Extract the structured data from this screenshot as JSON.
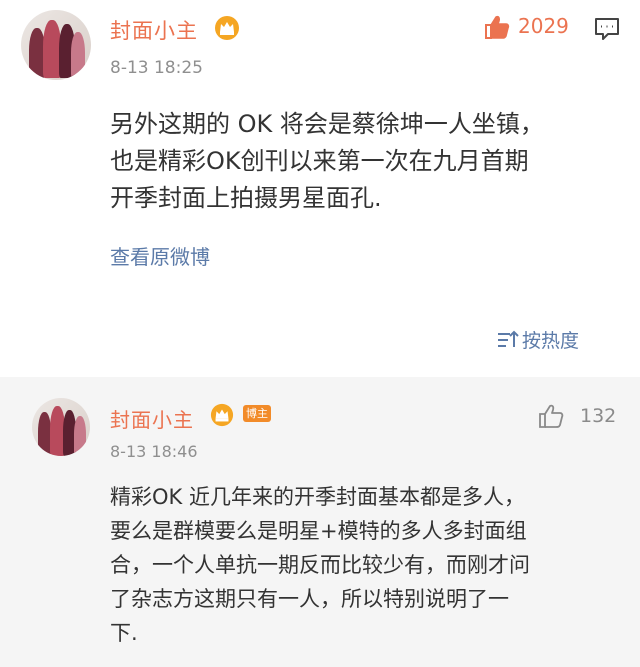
{
  "post": {
    "author": "封面小主",
    "timestamp": "8-13 18:25",
    "like_count": "2029",
    "content_lines": [
      "另外这期的 OK 将会是蔡徐坤一人坐镇，",
      "也是精彩OK创刊以来第一次在九月首期",
      "开季封面上拍摄男星面孔."
    ],
    "view_original_label": "查看原微博",
    "sort_label": "按热度"
  },
  "comment": {
    "author": "封面小主",
    "badge_label": "博主",
    "timestamp": "8-13 18:46",
    "like_count": "132",
    "content_lines": [
      "精彩OK 近几年来的开季封面基本都是多人，",
      "要么是群模要么是明星+模特的多人多封面组",
      "合，一个人单抗一期反而比较少有，而刚才问",
      "了杂志方这期只有一人，所以特别说明了一",
      "下."
    ]
  },
  "colors": {
    "accent": "#eb7350",
    "link": "#5b7aa8",
    "badge": "#f28b29",
    "meta": "#8f8f8f"
  },
  "icons": [
    "crown-icon",
    "thumbs-up-icon",
    "comment-icon",
    "sort-icon"
  ]
}
